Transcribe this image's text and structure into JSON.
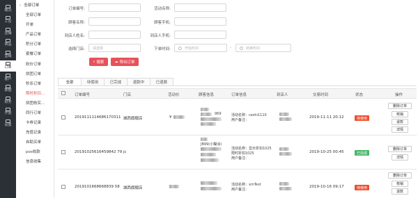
{
  "nav": [
    {
      "label": "概况",
      "icon": "dashboard-icon"
    },
    {
      "label": "工台",
      "icon": "workbench-icon"
    },
    {
      "label": "店铺",
      "icon": "store-icon"
    },
    {
      "label": "商品",
      "icon": "goods-icon"
    },
    {
      "label": "营销",
      "icon": "marketing-icon"
    },
    {
      "label": "订单",
      "icon": "order-icon",
      "active": true
    },
    {
      "label": "客户",
      "icon": "customer-icon"
    },
    {
      "label": "数据",
      "icon": "data-icon"
    },
    {
      "label": "财务",
      "icon": "finance-icon"
    },
    {
      "label": "开放",
      "icon": "open-icon"
    },
    {
      "label": "设置",
      "icon": "settings-icon"
    }
  ],
  "submenu": {
    "header": "全部订单",
    "items": [
      "全部订单",
      "开单",
      "产品订单",
      "积分订单",
      "套餐订单",
      "砍价订单",
      "拼团订单",
      "秒杀订单",
      "限时折扣...",
      "拼团核实...",
      "同行订单",
      "卡券记录",
      "充值记录",
      "自助买单",
      "pos收款",
      "信息收集"
    ],
    "active_index": 8
  },
  "filters": {
    "order_no": "订单编号:",
    "activity_name": "活动名称:",
    "customer_name": "顾客名称:",
    "customer_phone": "顾客手机:",
    "arrival_name": "到店人姓名:",
    "arrival_phone": "到店人手机:",
    "store_select": "选择门店:",
    "store_placeholder": "请选择",
    "order_time": "下单时间:",
    "start_placeholder": "开始时间",
    "end_placeholder": "结束时间",
    "dash": "-",
    "search_btn": "搜索",
    "export_btn": "导出订单"
  },
  "tabs": [
    "全部",
    "待使用",
    "已完成",
    "退款中",
    "已退款"
  ],
  "columns": {
    "order_no": "订单编号",
    "store": "门店",
    "activity_price": "活动价",
    "customer": "顾客信息",
    "order_info": "订单信息",
    "arrival": "到店人",
    "time": "交易时间",
    "status": "状态",
    "action": "操作"
  },
  "rows": [
    {
      "order_no": "2019111114686170311",
      "store": "城西旗舰店",
      "price": "¥",
      "customer_line": "969",
      "info_activity": "活动名称：ceshi1110",
      "info_note": "用户备注：",
      "arrival": "",
      "time": "2019-11-11 20:12",
      "status": "待使用",
      "status_kind": "pending",
      "actions": [
        "删除订单",
        "核销",
        "退款",
        "详情"
      ]
    },
    {
      "order_no": "20191025616459842 79",
      "store": "jc",
      "price": "",
      "customer_line": "JB99(小糊涂)",
      "info_activity": "活动名称：显示折扣1025",
      "info_note": "限时折扣1025",
      "info_note2": "用户备注：",
      "arrival": "",
      "time": "2019-10-25 00:45",
      "status": "已完成",
      "status_kind": "done",
      "actions": [
        "删除订单",
        "详情"
      ]
    },
    {
      "order_no": "2019101668668839 58",
      "store": "城西旗舰店",
      "price": "",
      "customer_line": "",
      "info_activity": "活动名称：xmTest",
      "info_note": "用户备注：",
      "arrival": "",
      "time": "2019-10-16 09:17",
      "status": "待使用",
      "status_kind": "pending",
      "actions": [
        "删除订单",
        "核销",
        "退款"
      ]
    }
  ]
}
